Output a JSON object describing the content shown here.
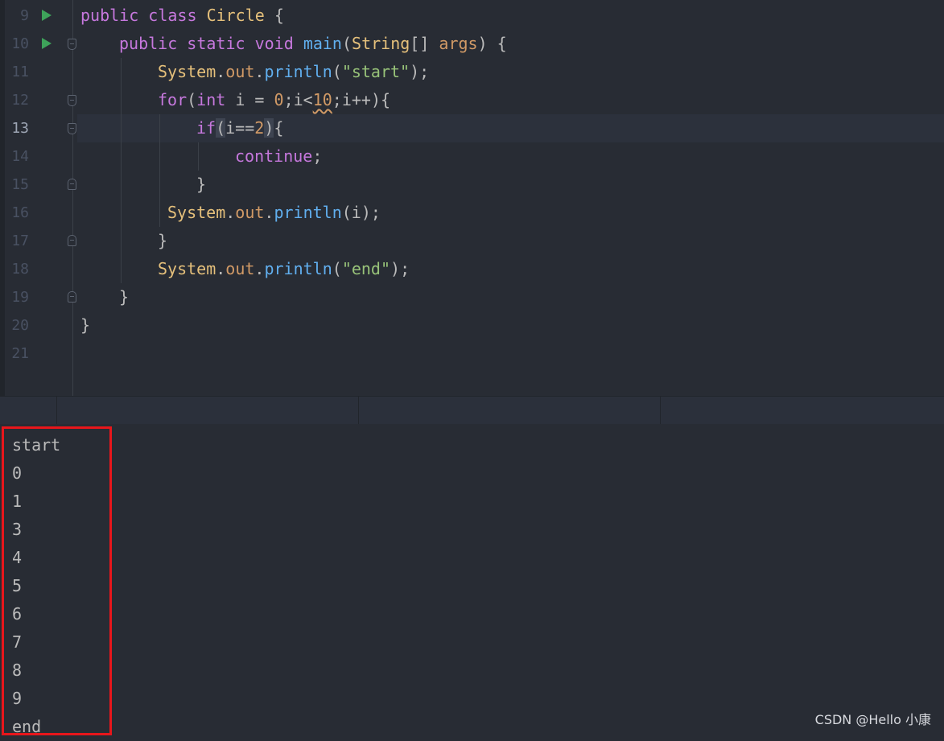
{
  "editor": {
    "line_numbers": [
      "9",
      "10",
      "11",
      "12",
      "13",
      "14",
      "15",
      "16",
      "17",
      "18",
      "19",
      "20",
      "21"
    ],
    "active_line": "13",
    "code": {
      "l9": {
        "kw1": "public",
        "kw2": "class",
        "name": "Circle",
        "brace": " {"
      },
      "l10": {
        "kw1": "public",
        "kw2": "static",
        "kw3": "void",
        "method": "main",
        "p1": "(",
        "type": "String",
        "p2": "[] ",
        "param": "args",
        "p3": ") {"
      },
      "l11": {
        "cls": "System",
        "dot1": ".",
        "fld": "out",
        "dot2": ".",
        "fn": "println",
        "p1": "(",
        "str": "\"start\"",
        "p2": ");"
      },
      "l12": {
        "kw": "for",
        "p1": "(",
        "kw2": "int",
        "p2": " i = ",
        "n1": "0",
        "p3": ";i<",
        "n2": "10",
        "p4": ";i++){"
      },
      "l13": {
        "kw": "if",
        "p1": "(",
        "p2": "i==",
        "n1": "2",
        "p3": ")",
        "p4": "{"
      },
      "l14": {
        "kw": "continue",
        "p1": ";"
      },
      "l15": {
        "p1": "}"
      },
      "l16": {
        "cls": "System",
        "dot1": ".",
        "fld": "out",
        "dot2": ".",
        "fn": "println",
        "p1": "(i);"
      },
      "l17": {
        "p1": "}"
      },
      "l18": {
        "cls": "System",
        "dot1": ".",
        "fld": "out",
        "dot2": ".",
        "fn": "println",
        "p1": "(",
        "str": "\"end\"",
        "p2": ");"
      },
      "l19": {
        "p1": "}"
      },
      "l20": {
        "p1": "}"
      }
    }
  },
  "console": {
    "output": [
      "start",
      "0",
      "1",
      "3",
      "4",
      "5",
      "6",
      "7",
      "8",
      "9",
      "end"
    ]
  },
  "watermark": "CSDN @Hello 小康",
  "colors": {
    "background": "#282c34",
    "keyword": "#c678dd",
    "class": "#e5c07b",
    "function": "#61afef",
    "string": "#98c379",
    "number": "#d19a66",
    "highlight_box": "#e8161b",
    "run_icon": "#3ea35a"
  }
}
